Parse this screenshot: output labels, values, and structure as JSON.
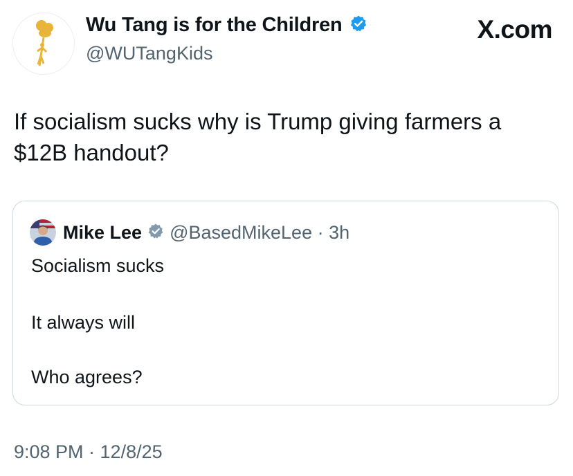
{
  "brand": "X.com",
  "author": {
    "display_name": "Wu Tang is for the Children",
    "handle": "@WUTangKids",
    "avatar_icon": "balloon-figure-logo",
    "verified_icon": "verified-badge-icon"
  },
  "tweet": {
    "lines": [
      "If socialism sucks why is Trump giving farmers a",
      "$12B handout?"
    ]
  },
  "quoted_tweet": {
    "display_name": "Mike Lee",
    "handle_time": "@BasedMikeLee · 3h",
    "lines": [
      "Socialism sucks",
      "It always will",
      "Who agrees?"
    ],
    "verified_icon": "verified-badge-grey-icon"
  },
  "timestamp": "9:08 PM · 12/8/25",
  "colors": {
    "text": "#0f1419",
    "secondary": "#536471",
    "verified_blue": "#1d9bf0",
    "verified_grey": "#829aab",
    "border": "#cfd9de",
    "logo_gold": "#e8b53a"
  }
}
